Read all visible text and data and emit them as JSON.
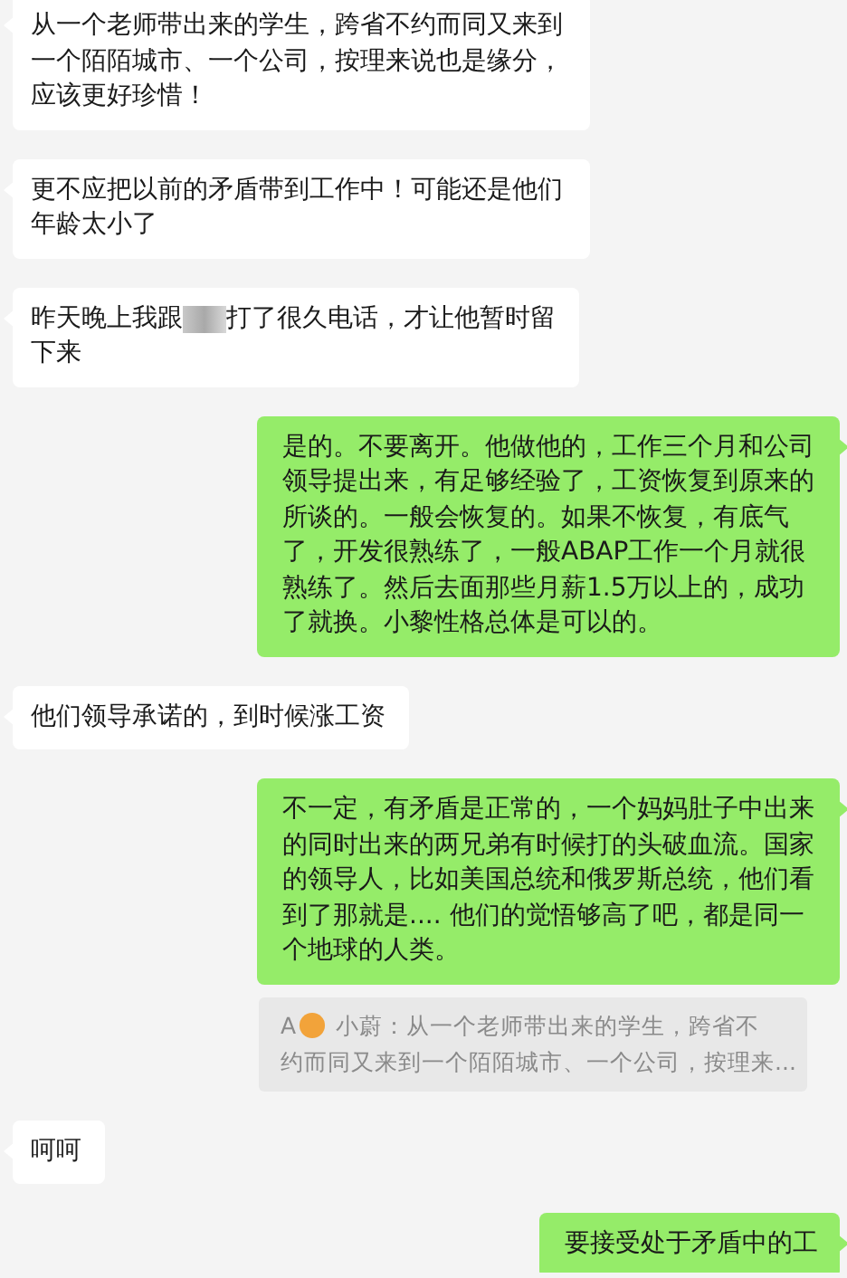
{
  "messages": [
    {
      "kind": "text",
      "outgoing": false,
      "text": "从一个老师带出来的学生，跨省不约而同又来到一个陌陌城市、一个公司，按理来说也是缘分，应该更好珍惜！"
    },
    {
      "kind": "text",
      "outgoing": false,
      "text": "更不应把以前的矛盾带到工作中！可能还是他们年龄太小了"
    },
    {
      "kind": "redacted",
      "outgoing": false,
      "lines": [
        [
          "昨天晚上我跟",
          "打了很久电话，才让他暂时留"
        ],
        [
          "下来"
        ]
      ]
    },
    {
      "kind": "text",
      "outgoing": true,
      "text": "是的。不要离开。他做他的，工作三个月和公司领导提出来，有足够经验了，工资恢复到原来的所谈的。一般会恢复的。如果不恢复，有底气了，开发很熟练了，一般ABAP工作一个月就很熟练了。然后去面那些月薪1.5万以上的，成功了就换。小黎性格总体是可以的。"
    },
    {
      "kind": "text",
      "outgoing": false,
      "text": "他们领导承诺的，到时候涨工资"
    },
    {
      "kind": "text",
      "outgoing": true,
      "text": "不一定，有矛盾是正常的，一个妈妈肚子中出来的同时出来的两兄弟有时候打的头破血流。国家的领导人，比如美国总统和俄罗斯总统，他们看到了那就是.... 他们的觉悟够高了吧，都是同一个地球的人类。"
    },
    {
      "kind": "quote",
      "author": "A",
      "lines": [
        "小蔚：从一个老师带出来的学生，跨省不",
        "约而同又来到一个陌陌城市、一个公司，按理来..."
      ]
    },
    {
      "kind": "text",
      "outgoing": false,
      "text": "呵呵"
    },
    {
      "kind": "text",
      "outgoing": true,
      "text": "要接受处于矛盾中的工"
    }
  ]
}
